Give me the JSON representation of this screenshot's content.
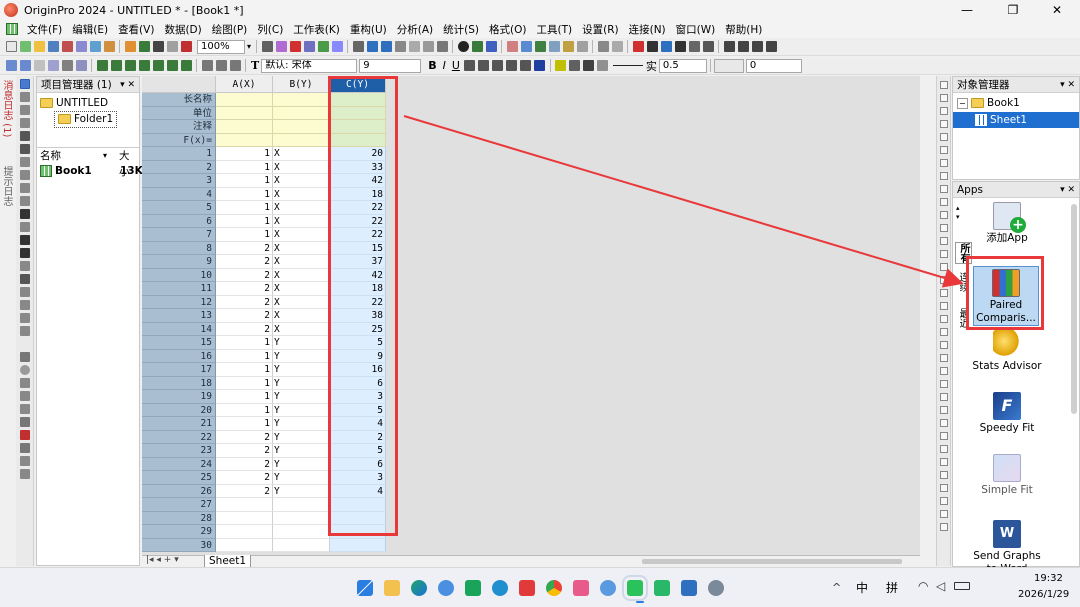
{
  "window": {
    "title": "OriginPro 2024 - UNTITLED * - [Book1 *]",
    "controls": {
      "minimize": "—",
      "maximize": "❐",
      "close": "✕"
    }
  },
  "menu": [
    "文件(F)",
    "编辑(E)",
    "查看(V)",
    "数据(D)",
    "绘图(P)",
    "列(C)",
    "工作表(K)",
    "重构(U)",
    "分析(A)",
    "统计(S)",
    "格式(O)",
    "工具(T)",
    "设置(R)",
    "连接(N)",
    "窗口(W)",
    "帮助(H)"
  ],
  "toolbar": {
    "zoom": "100%",
    "font": "默认: 宋体",
    "font_size": "9",
    "bold": "B",
    "italic": "I",
    "underline": "U",
    "line_style": "实",
    "line_width": "0.5",
    "value": "0"
  },
  "side_tabs": [
    "消息日志 (1)",
    "提示日志"
  ],
  "project_manager": {
    "title": "项目管理器 (1)",
    "root": "UNTITLED",
    "folder": "Folder1",
    "col_name": "名称",
    "col_size": "大小",
    "items": [
      {
        "name": "Book1",
        "size": "13K"
      }
    ]
  },
  "worksheet": {
    "columns": [
      "A(X)",
      "B(Y)",
      "C(Y)"
    ],
    "meta_rows": [
      "长名称",
      "单位",
      "注释",
      "F(x)="
    ],
    "rows": [
      [
        "1",
        "X",
        "20"
      ],
      [
        "1",
        "X",
        "33"
      ],
      [
        "1",
        "X",
        "42"
      ],
      [
        "1",
        "X",
        "18"
      ],
      [
        "1",
        "X",
        "22"
      ],
      [
        "1",
        "X",
        "22"
      ],
      [
        "1",
        "X",
        "22"
      ],
      [
        "2",
        "X",
        "15"
      ],
      [
        "2",
        "X",
        "37"
      ],
      [
        "2",
        "X",
        "42"
      ],
      [
        "2",
        "X",
        "18"
      ],
      [
        "2",
        "X",
        "22"
      ],
      [
        "2",
        "X",
        "38"
      ],
      [
        "2",
        "X",
        "25"
      ],
      [
        "1",
        "Y",
        "5"
      ],
      [
        "1",
        "Y",
        "9"
      ],
      [
        "1",
        "Y",
        "16"
      ],
      [
        "1",
        "Y",
        "6"
      ],
      [
        "1",
        "Y",
        "3"
      ],
      [
        "1",
        "Y",
        "5"
      ],
      [
        "1",
        "Y",
        "4"
      ],
      [
        "2",
        "Y",
        "2"
      ],
      [
        "2",
        "Y",
        "5"
      ],
      [
        "2",
        "Y",
        "6"
      ],
      [
        "2",
        "Y",
        "3"
      ],
      [
        "2",
        "Y",
        "4"
      ],
      [
        "",
        "",
        ""
      ],
      [
        "",
        "",
        ""
      ],
      [
        "",
        "",
        ""
      ],
      [
        "",
        "",
        ""
      ]
    ],
    "sheet_tab": "Sheet1"
  },
  "object_manager": {
    "title": "对象管理器",
    "book": "Book1",
    "sheet": "Sheet1"
  },
  "apps": {
    "title": "Apps",
    "side_tabs": [
      "所有",
      "连续",
      "最近"
    ],
    "items": [
      "添加App",
      "Paired Comparis...",
      "Stats Advisor",
      "Speedy Fit",
      "Simple Fit",
      "Send Graphs to Word"
    ]
  },
  "taskbar": {
    "ime_lang": "中",
    "ime_mode": "拼",
    "time": "19:32",
    "date": "2026/1/29"
  },
  "colors": {
    "highlight": "#e8383a",
    "selected_header": "#1f5fa8"
  }
}
